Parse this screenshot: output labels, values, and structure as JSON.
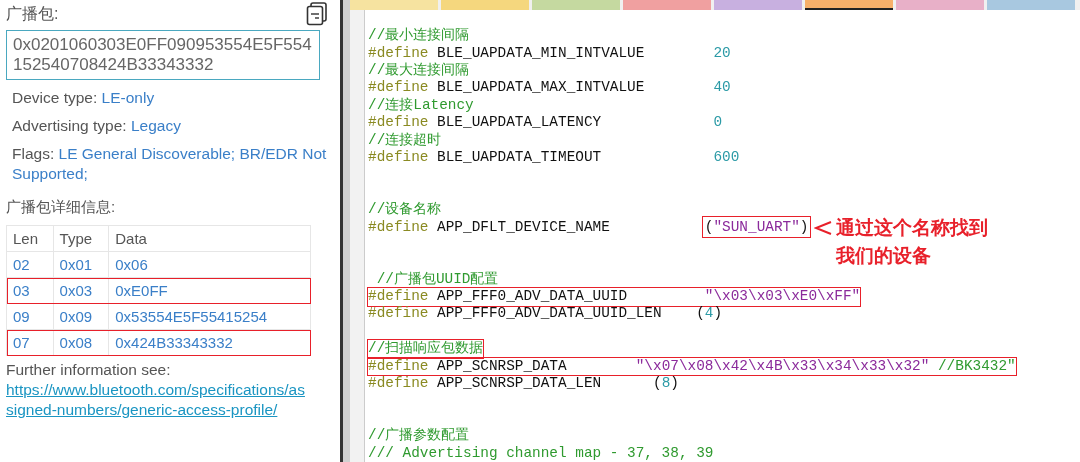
{
  "advert_panel": {
    "title": "广播包:",
    "raw_data": "0x0201060303E0FF090953554E5F554152540708424B33343332",
    "properties": [
      {
        "label": "Device type: ",
        "value": "LE-only"
      },
      {
        "label": "Advertising type: ",
        "value": "Legacy"
      },
      {
        "label": "Flags: ",
        "value": "LE General Discoverable; BR/EDR Not Supported;"
      }
    ],
    "details_title": "广播包详细信息:",
    "table": {
      "columns": [
        "Len",
        "Type",
        "Data"
      ],
      "rows": [
        {
          "cells": [
            "02",
            "0x01",
            "0x06"
          ],
          "highlighted": false
        },
        {
          "cells": [
            "03",
            "0x03",
            "0xE0FF"
          ],
          "highlighted": true
        },
        {
          "cells": [
            "09",
            "0x09",
            "0x53554E5F55415254"
          ],
          "highlighted": false
        },
        {
          "cells": [
            "07",
            "0x08",
            "0x424B33343332"
          ],
          "highlighted": true
        }
      ]
    },
    "further_info": {
      "text": "Further information see: ",
      "link": "https://www.bluetooth.com/specifications/assigned-numbers/generic-access-profile/"
    }
  },
  "editor": {
    "tabs": [
      {
        "color": "#f6e3a0",
        "selected": false
      },
      {
        "color": "#f5d77e",
        "selected": false
      },
      {
        "color": "#c5d9a0",
        "selected": false
      },
      {
        "color": "#f0a0a0",
        "selected": false
      },
      {
        "color": "#c8b0e0",
        "selected": false
      },
      {
        "color": "#f7b06a",
        "selected": true
      },
      {
        "color": "#e8b0c8",
        "selected": false
      },
      {
        "color": "#a8c8e0",
        "selected": false
      }
    ],
    "lines": [
      {
        "kind": "blank"
      },
      {
        "kind": "code",
        "highlighted": false,
        "tokens": [
          {
            "kind": "comment",
            "text": "//最小连接间隔"
          }
        ]
      },
      {
        "kind": "code",
        "highlighted": false,
        "tokens": [
          {
            "kind": "keyword",
            "text": "#define "
          },
          {
            "kind": "ident",
            "text": "BLE_UAPDATA_MIN_INTVALUE        "
          },
          {
            "kind": "number",
            "text": "20"
          }
        ]
      },
      {
        "kind": "code",
        "highlighted": false,
        "tokens": [
          {
            "kind": "comment",
            "text": "//最大连接间隔"
          }
        ]
      },
      {
        "kind": "code",
        "highlighted": false,
        "tokens": [
          {
            "kind": "keyword",
            "text": "#define "
          },
          {
            "kind": "ident",
            "text": "BLE_UAPDATA_MAX_INTVALUE        "
          },
          {
            "kind": "number",
            "text": "40"
          }
        ]
      },
      {
        "kind": "code",
        "highlighted": false,
        "tokens": [
          {
            "kind": "comment",
            "text": "//连接Latency"
          }
        ]
      },
      {
        "kind": "code",
        "highlighted": false,
        "tokens": [
          {
            "kind": "keyword",
            "text": "#define "
          },
          {
            "kind": "ident",
            "text": "BLE_UAPDATA_LATENCY             "
          },
          {
            "kind": "number",
            "text": "0"
          }
        ]
      },
      {
        "kind": "code",
        "highlighted": false,
        "tokens": [
          {
            "kind": "comment",
            "text": "//连接超时"
          }
        ]
      },
      {
        "kind": "code",
        "highlighted": false,
        "tokens": [
          {
            "kind": "keyword",
            "text": "#define "
          },
          {
            "kind": "ident",
            "text": "BLE_UAPDATA_TIMEOUT             "
          },
          {
            "kind": "number",
            "text": "600"
          }
        ]
      },
      {
        "kind": "blank"
      },
      {
        "kind": "blank"
      },
      {
        "kind": "code",
        "highlighted": false,
        "tokens": [
          {
            "kind": "comment",
            "text": "//设备名称"
          }
        ]
      },
      {
        "kind": "code",
        "highlighted": false,
        "tokens": [
          {
            "kind": "keyword",
            "text": "#define "
          },
          {
            "kind": "ident",
            "text": "APP_DFLT_DEVICE_NAME           "
          },
          {
            "kind": "boxed",
            "parts": [
              {
                "kind": "ident",
                "text": "("
              },
              {
                "kind": "string",
                "text": "\"SUN_UART\""
              },
              {
                "kind": "ident",
                "text": ")"
              }
            ]
          }
        ],
        "callout": [
          "通过这个名称找到",
          "我们的设备"
        ]
      },
      {
        "kind": "blank"
      },
      {
        "kind": "blank"
      },
      {
        "kind": "code",
        "highlighted": false,
        "tokens": [
          {
            "kind": "comment",
            "text": " //广播包UUID配置"
          }
        ]
      },
      {
        "kind": "code",
        "highlighted": true,
        "tokens": [
          {
            "kind": "keyword",
            "text": "#define "
          },
          {
            "kind": "ident",
            "text": "APP_FFF0_ADV_DATA_UUID         "
          },
          {
            "kind": "string",
            "text": "\"\\x03\\x03\\xE0\\xFF\""
          }
        ]
      },
      {
        "kind": "code",
        "highlighted": false,
        "tokens": [
          {
            "kind": "keyword",
            "text": "#define "
          },
          {
            "kind": "ident",
            "text": "APP_FFF0_ADV_DATA_UUID_LEN    "
          },
          {
            "kind": "ident",
            "text": "("
          },
          {
            "kind": "number",
            "text": "4"
          },
          {
            "kind": "ident",
            "text": ")"
          }
        ]
      },
      {
        "kind": "blank"
      },
      {
        "kind": "code",
        "highlighted": true,
        "tokens": [
          {
            "kind": "comment",
            "text": "//扫描响应包数据"
          }
        ]
      },
      {
        "kind": "code",
        "highlighted": true,
        "tokens": [
          {
            "kind": "keyword",
            "text": "#define "
          },
          {
            "kind": "ident",
            "text": "APP_SCNRSP_DATA        "
          },
          {
            "kind": "string",
            "text": "\"\\x07\\x08\\x42\\x4B\\x33\\x34\\x33\\x32\""
          },
          {
            "kind": "comment",
            "text": " //BK3432\""
          }
        ]
      },
      {
        "kind": "code",
        "highlighted": false,
        "tokens": [
          {
            "kind": "keyword",
            "text": "#define "
          },
          {
            "kind": "ident",
            "text": "APP_SCNRSP_DATA_LEN      "
          },
          {
            "kind": "ident",
            "text": "("
          },
          {
            "kind": "number",
            "text": "8"
          },
          {
            "kind": "ident",
            "text": ")"
          }
        ]
      },
      {
        "kind": "blank"
      },
      {
        "kind": "blank"
      },
      {
        "kind": "code",
        "highlighted": false,
        "tokens": [
          {
            "kind": "comment",
            "text": "//广播参数配置"
          }
        ]
      },
      {
        "kind": "code",
        "highlighted": false,
        "tokens": [
          {
            "kind": "comment",
            "text": "/// Advertising channel map - 37, 38, 39"
          }
        ]
      }
    ]
  }
}
